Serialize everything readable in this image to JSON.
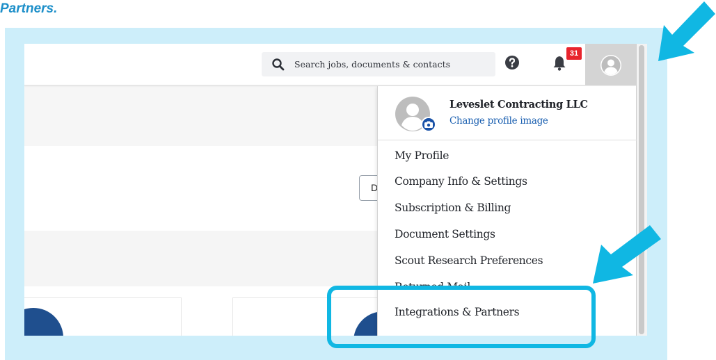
{
  "caption": "Partners.",
  "search": {
    "placeholder": "Search jobs, documents & contacts",
    "icon": "search-icon"
  },
  "header": {
    "notifications_count": "31"
  },
  "background": {
    "partial_button_label": "D"
  },
  "dropdown": {
    "company_name": "Leveslet Contracting LLC",
    "change_image": "Change profile image",
    "items": [
      {
        "label": "My Profile"
      },
      {
        "label": "Company Info & Settings"
      },
      {
        "label": "Subscription & Billing"
      },
      {
        "label": "Document Settings"
      },
      {
        "label": "Scout Research Preferences"
      },
      {
        "label": "Returned Mail"
      },
      {
        "label": "Integrations & Partners"
      }
    ]
  },
  "colors": {
    "accent_cyan": "#10b7e3",
    "frame_bg": "#cdeefa",
    "caption": "#1d8fc9",
    "link": "#1a5fb0",
    "badge": "#e8242d",
    "brand_blue": "#1f4f8e"
  }
}
